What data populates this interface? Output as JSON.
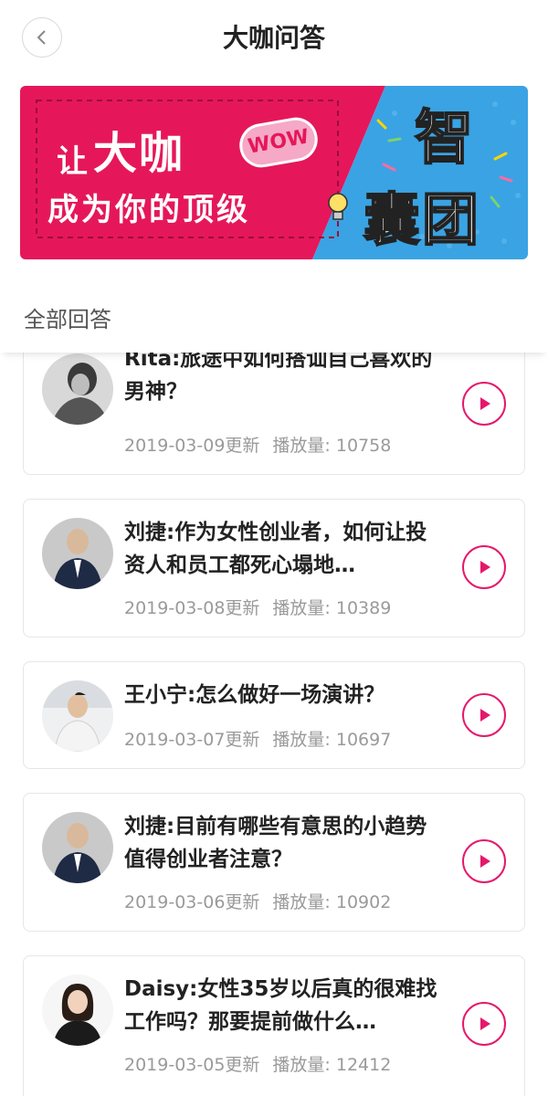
{
  "header": {
    "title": "大咖问答",
    "back_icon": "chevron-left-icon"
  },
  "banner": {
    "line1_prefix": "让",
    "line1_big": "大咖",
    "line2": "成为你的顶级",
    "badge": "WOW",
    "side_top": "智",
    "side_bottom": "囊团",
    "colors": {
      "left": "#e5175a",
      "right": "#3aa3e3",
      "text": "#ffffff",
      "badge": "#f5a9c6"
    }
  },
  "section": {
    "label": "全部回答"
  },
  "accent_color": "#e5186b",
  "items": [
    {
      "title": "Rita:旅途中如何搭讪自己喜欢的男神？",
      "date": "2019-03-09更新",
      "plays": "播放量: 10758",
      "avatar": "woman-portrait"
    },
    {
      "title": "刘捷:作为女性创业者，如何让投资人和员工都死心塌地…",
      "date": "2019-03-08更新",
      "plays": "播放量: 10389",
      "avatar": "man-suit-portrait"
    },
    {
      "title": "王小宁:怎么做好一场演讲？",
      "date": "2019-03-07更新",
      "plays": "播放量: 10697",
      "avatar": "man-office-portrait"
    },
    {
      "title": "刘捷:目前有哪些有意思的小趋势值得创业者注意？",
      "date": "2019-03-06更新",
      "plays": "播放量: 10902",
      "avatar": "man-suit-portrait"
    },
    {
      "title": "Daisy:女性35岁以后真的很难找工作吗？那要提前做什么…",
      "date": "2019-03-05更新",
      "plays": "播放量: 12412",
      "avatar": "woman-smiling-portrait"
    }
  ]
}
